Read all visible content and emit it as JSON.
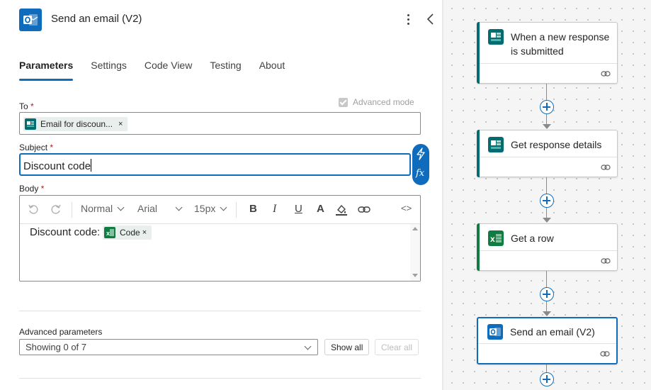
{
  "header": {
    "title": "Send an email (V2)",
    "icon": "outlook-icon",
    "more_icon": "more-vertical-icon",
    "collapse_icon": "chevron-left-icon"
  },
  "tabs": [
    {
      "label": "Parameters",
      "active": true
    },
    {
      "label": "Settings",
      "active": false
    },
    {
      "label": "Code View",
      "active": false
    },
    {
      "label": "Testing",
      "active": false
    },
    {
      "label": "About",
      "active": false
    }
  ],
  "advanced_mode": {
    "label": "Advanced mode",
    "checked": true,
    "disabled": true
  },
  "to_field": {
    "label": "To",
    "required_mark": "*",
    "token": {
      "text": "Email for discoun...",
      "remove": "×",
      "icon": "forms-icon"
    }
  },
  "subject_field": {
    "label": "Subject",
    "required_mark": "*",
    "value": "Discount code",
    "dynamic_content_icon": "lightning-icon",
    "expression_icon": "fx",
    "icons": [
      "lightning-icon",
      "fx-icon"
    ]
  },
  "body_field": {
    "label": "Body",
    "required_mark": "*",
    "toolbar": {
      "undo_icon": "undo-icon",
      "redo_icon": "redo-icon",
      "style": "Normal",
      "font": "Arial",
      "size": "15px",
      "format_icons": [
        "bold-icon",
        "italic-icon",
        "underline-icon",
        "font-color-icon",
        "highlight-icon",
        "link-icon",
        "code-view-icon"
      ],
      "bold": "B",
      "italic": "I",
      "underline": "U",
      "font_color": "A",
      "code_view": "<>"
    },
    "content_text": "Discount code:",
    "token": {
      "text": "Code",
      "remove": "×",
      "icon": "excel-icon"
    }
  },
  "advanced_parameters": {
    "label": "Advanced parameters",
    "select_value": "Showing 0 of 7",
    "show_all": "Show all",
    "clear_all": "Clear all"
  },
  "flow": {
    "steps": [
      {
        "title": "When a new response is submitted",
        "icon": "forms-icon",
        "accent": "#036c70",
        "selected": false
      },
      {
        "title": "Get response details",
        "icon": "forms-icon",
        "accent": "#036c70",
        "selected": false
      },
      {
        "title": "Get a row",
        "icon": "excel-icon",
        "accent": "#107c41",
        "selected": false
      },
      {
        "title": "Send an email (V2)",
        "icon": "outlook-icon",
        "accent": "#0f6cbd",
        "selected": true
      }
    ],
    "link_icon": "link-icon",
    "add_icon": "add-step-icon"
  },
  "colors": {
    "accent": "#0f6cbd",
    "forms": "#036c70",
    "excel": "#107c41",
    "required": "#c50f1f"
  }
}
